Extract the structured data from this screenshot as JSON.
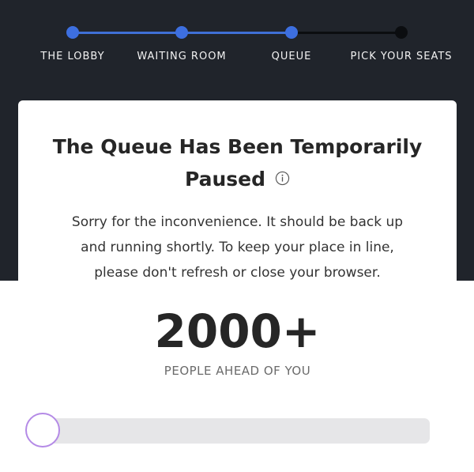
{
  "stepper": {
    "steps": [
      {
        "label": "THE LOBBY",
        "state": "done"
      },
      {
        "label": "WAITING ROOM",
        "state": "done"
      },
      {
        "label": "QUEUE",
        "state": "current"
      },
      {
        "label": "PICK YOUR SEATS",
        "state": "upcoming"
      }
    ]
  },
  "card": {
    "title_line1": "The Queue Has Been Temporarily",
    "title_line2": "Paused",
    "info_icon": "info-icon",
    "message": "Sorry for the inconvenience. It should be back up and running shortly. To keep your place in line, please don't refresh or close your browser.",
    "count": "2000+",
    "count_label": "PEOPLE AHEAD OF YOU",
    "progress": 0
  },
  "colors": {
    "header_bg": "#20242b",
    "step_done": "#3d6fe0",
    "step_todo": "#0b0d10",
    "progress_accent": "#b48ae6"
  }
}
